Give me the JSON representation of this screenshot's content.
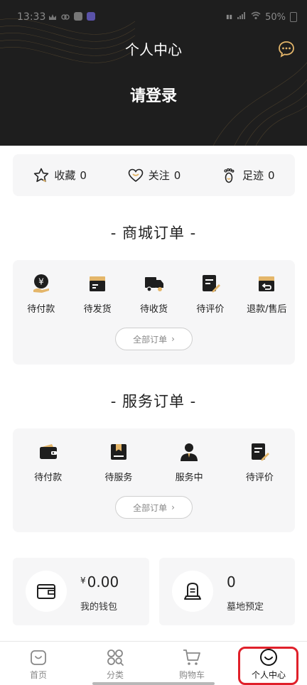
{
  "status_bar": {
    "time": "13:33",
    "battery": "50%"
  },
  "header": {
    "title": "个人中心",
    "login_prompt": "请登录"
  },
  "quick_stats": [
    {
      "label": "收藏",
      "count": "0",
      "icon": "star-icon"
    },
    {
      "label": "关注",
      "count": "0",
      "icon": "heart-icon"
    },
    {
      "label": "足迹",
      "count": "0",
      "icon": "footprint-icon"
    }
  ],
  "mall_orders": {
    "title": "- 商城订单 -",
    "items": [
      {
        "label": "待付款",
        "icon": "yuan-hand-icon"
      },
      {
        "label": "待发货",
        "icon": "box-icon"
      },
      {
        "label": "待收货",
        "icon": "truck-icon"
      },
      {
        "label": "待评价",
        "icon": "review-pen-icon"
      },
      {
        "label": "退款/售后",
        "icon": "return-box-icon"
      }
    ],
    "all_label": "全部订单"
  },
  "service_orders": {
    "title": "- 服务订单 -",
    "items": [
      {
        "label": "待付款",
        "icon": "wallet-icon"
      },
      {
        "label": "待服务",
        "icon": "service-box-icon"
      },
      {
        "label": "服务中",
        "icon": "person-icon"
      },
      {
        "label": "待评价",
        "icon": "review-pen-icon"
      }
    ],
    "all_label": "全部订单"
  },
  "assets": [
    {
      "value": "0.00",
      "currency": "¥",
      "label": "我的钱包",
      "icon": "wallet-outline-icon"
    },
    {
      "value": "0",
      "label": "墓地预定",
      "icon": "tombstone-icon"
    }
  ],
  "tabbar": [
    {
      "label": "首页",
      "icon": "home-bag-icon",
      "active": false
    },
    {
      "label": "分类",
      "icon": "category-icon",
      "active": false
    },
    {
      "label": "购物车",
      "icon": "cart-icon",
      "active": false
    },
    {
      "label": "个人中心",
      "icon": "smile-icon",
      "active": true
    }
  ],
  "colors": {
    "header_bg": "#1e1e1e",
    "accent_gold": "#e4b66a",
    "card_bg": "#f6f6f7",
    "highlight_red": "#e0202a"
  }
}
